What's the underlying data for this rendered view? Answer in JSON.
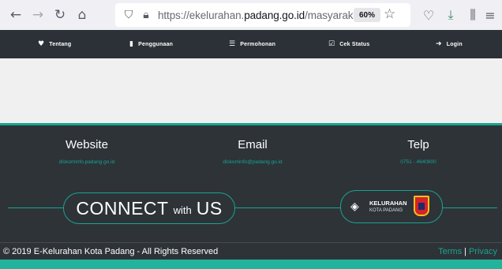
{
  "browser": {
    "url_prefix": "https://ekelurahan.",
    "url_domain": "padang.go.id",
    "url_path": "/masyarakat",
    "zoom": "60%",
    "icons": [
      "back-arrow",
      "forward-arrow",
      "reload",
      "home",
      "shield",
      "lock",
      "star",
      "pocket",
      "downloads",
      "library",
      "menu"
    ]
  },
  "nav": {
    "items": [
      {
        "icon": "♥",
        "label": "Tentang"
      },
      {
        "icon": "▮",
        "label": "Penggunaan"
      },
      {
        "icon": "☰",
        "label": "Permohonan"
      },
      {
        "icon": "☑",
        "label": "Cek Status"
      },
      {
        "icon": "➜",
        "label": "Login"
      }
    ]
  },
  "footer": {
    "website": {
      "title": "Website",
      "value": "diskominfo.padang.go.id"
    },
    "email": {
      "title": "Email",
      "value": "diskominfo@padang.go.id"
    },
    "telp": {
      "title": "Telp",
      "value": "0751 - 4640800"
    },
    "connect": {
      "big1": "CONNECT",
      "small": "with",
      "big2": "US"
    },
    "logo": {
      "title": "KELURAHAN",
      "subtitle": "KOTA PADANG"
    },
    "copyright": "© 2019 E-Kelurahan Kota Padang - All Rights Reserved",
    "terms": "Terms",
    "separator": "|",
    "privacy": "Privacy"
  },
  "colors": {
    "accent": "#1aa38f",
    "nav_bg": "#2b3136",
    "footer_bg": "#2e3338"
  }
}
